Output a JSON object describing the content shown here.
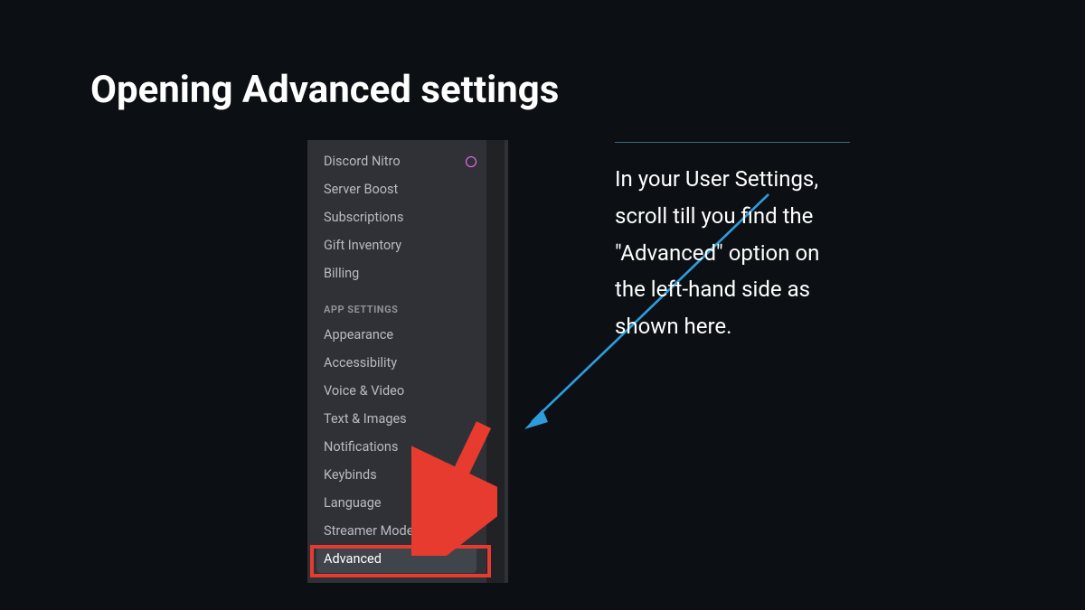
{
  "title": "Opening Advanced settings",
  "sidebar": {
    "topItems": [
      "Discord Nitro",
      "Server Boost",
      "Subscriptions",
      "Gift Inventory",
      "Billing"
    ],
    "sectionHeader": "APP SETTINGS",
    "appItems": [
      "Appearance",
      "Accessibility",
      "Voice & Video",
      "Text & Images",
      "Notifications",
      "Keybinds",
      "Language",
      "Streamer Mode"
    ],
    "selectedItem": "Advanced"
  },
  "instruction": "In your User Settings, scroll till you find the \"Advanced\" option on the left-hand side as shown here."
}
